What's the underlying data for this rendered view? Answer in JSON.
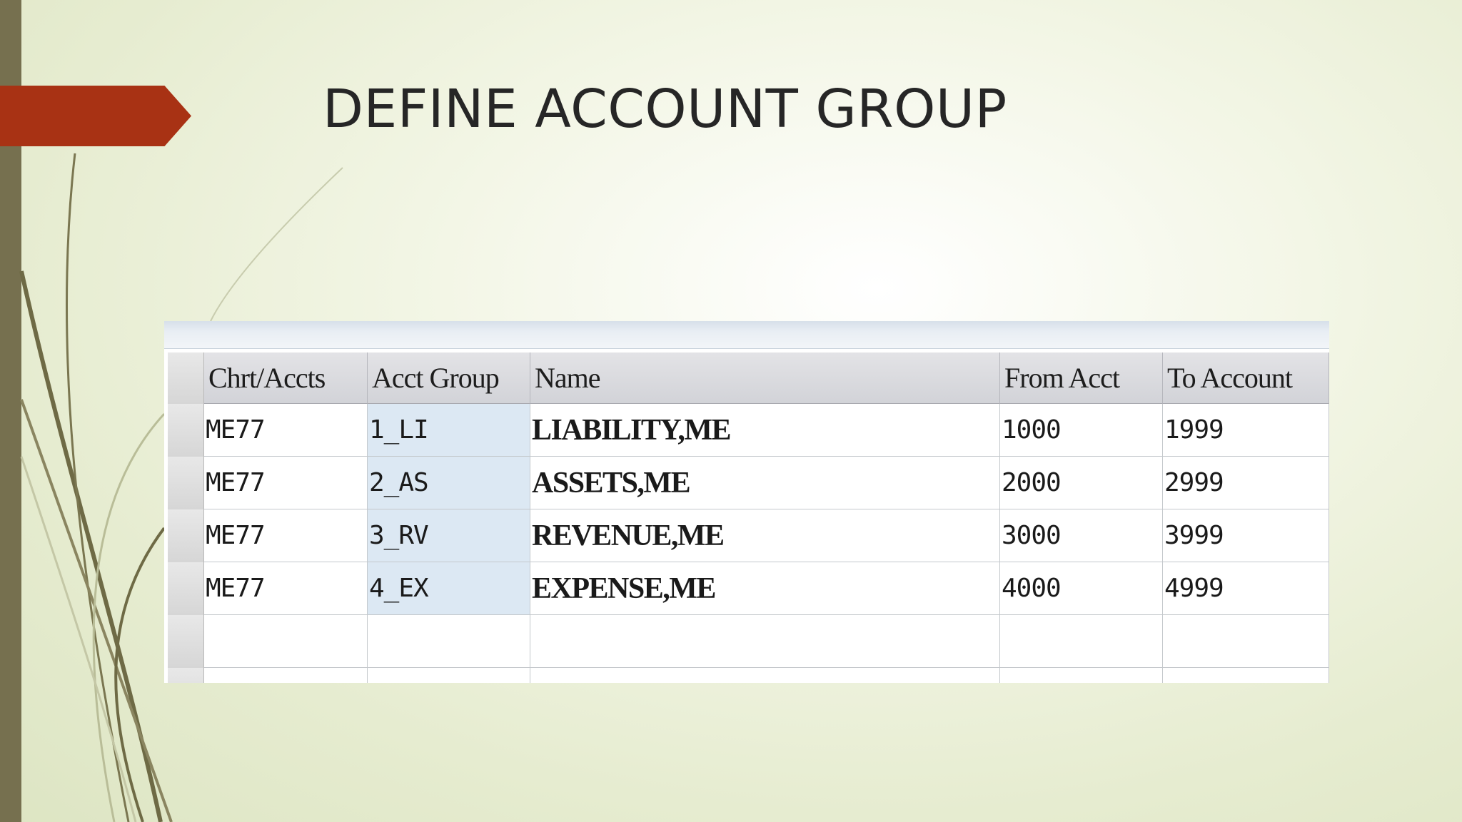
{
  "slide": {
    "title": "DEFINE ACCOUNT GROUP"
  },
  "table": {
    "columns": [
      "Chrt/Accts",
      "Acct Group",
      "Name",
      "From Acct",
      "To Account"
    ],
    "rows": [
      [
        "ME77",
        "1_LI",
        "LIABILITY,ME",
        "1000",
        "1999"
      ],
      [
        "ME77",
        "2_AS",
        "ASSETS,ME",
        "2000",
        "2999"
      ],
      [
        "ME77",
        "3_RV",
        "REVENUE,ME",
        "3000",
        "3999"
      ],
      [
        "ME77",
        "4_EX",
        "EXPENSE,ME",
        "4000",
        "4999"
      ]
    ]
  },
  "colors": {
    "accent_arrow": "#a83214",
    "left_bar": "#76704f",
    "key_cell": "#dce8f3"
  }
}
